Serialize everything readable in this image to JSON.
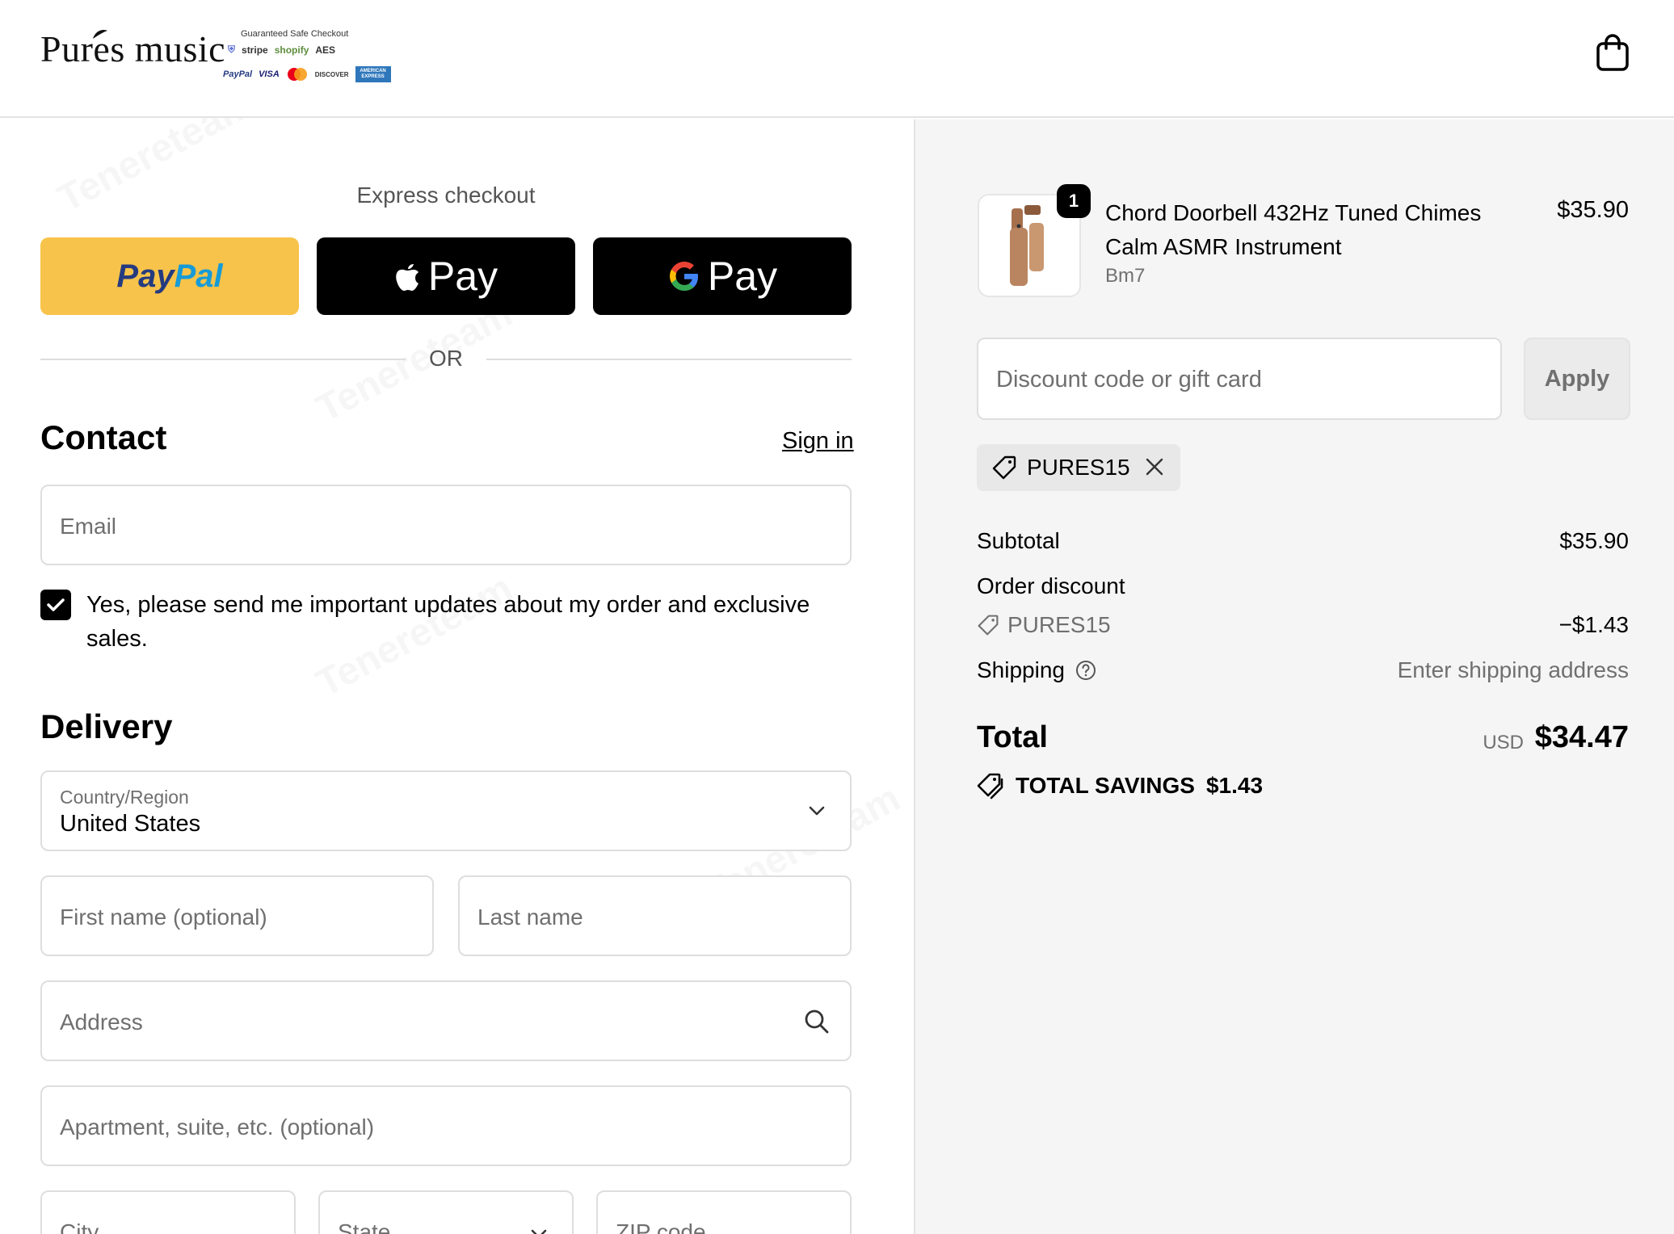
{
  "brand": {
    "name": "Pures music",
    "badges_title": "Guaranteed Safe Checkout",
    "badges_row1": [
      "stripe",
      "shopify",
      "AES"
    ],
    "badges_row2": [
      "PayPal",
      "VISA",
      "DISCOVER",
      "AMERICAN EXPRESS"
    ]
  },
  "express": {
    "title": "Express checkout",
    "paypal_pay": "Pay",
    "paypal_pal": "Pal",
    "apple_pay": "Pay",
    "google_pay": "Pay",
    "or": "OR"
  },
  "contact": {
    "title": "Contact",
    "sign_in": "Sign in",
    "email_placeholder": "Email",
    "marketing_optin": "Yes, please send me important updates about my order and exclusive sales.",
    "marketing_checked": true
  },
  "delivery": {
    "title": "Delivery",
    "country_label": "Country/Region",
    "country_value": "United States",
    "first_name_placeholder": "First name (optional)",
    "last_name_placeholder": "Last name",
    "address_placeholder": "Address",
    "apartment_placeholder": "Apartment, suite, etc. (optional)",
    "city_placeholder": "City",
    "state_placeholder": "State",
    "zip_placeholder": "ZIP code"
  },
  "summary": {
    "item": {
      "quantity": "1",
      "name": "Chord Doorbell 432Hz Tuned Chimes Calm ASMR Instrument",
      "variant": "Bm7",
      "price": "$35.90"
    },
    "discount_placeholder": "Discount code or gift card",
    "apply": "Apply",
    "applied_code": "PURES15",
    "subtotal_label": "Subtotal",
    "subtotal_value": "$35.90",
    "order_discount_label": "Order discount",
    "discount_code": "PURES15",
    "discount_value": "−$1.43",
    "shipping_label": "Shipping",
    "shipping_value": "Enter shipping address",
    "total_label": "Total",
    "total_currency": "USD",
    "total_value": "$34.47",
    "savings_label": "TOTAL SAVINGS",
    "savings_value": "$1.43"
  },
  "watermark": "Tenereteam",
  "colors": {
    "paypal_yellow": "#f7c34a",
    "paypal_blue_dark": "#253b80",
    "paypal_blue_light": "#179bd7",
    "summary_bg": "#f5f5f5",
    "muted_text": "#707070"
  }
}
